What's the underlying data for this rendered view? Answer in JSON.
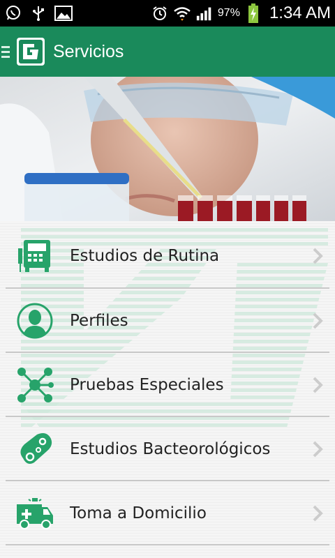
{
  "status_bar": {
    "battery": "97%",
    "time": "1:34 AM",
    "icons": [
      "whatsapp-icon",
      "usb-icon",
      "gallery-icon",
      "alarm-icon",
      "wifi-icon",
      "signal-icon",
      "battery-charging-icon"
    ]
  },
  "action_bar": {
    "title": "Servicios",
    "logo_text": "G"
  },
  "colors": {
    "primary": "#1a8a5b",
    "accent": "#27a36a",
    "text": "#222222",
    "chevron": "#cccccc"
  },
  "menu": {
    "items": [
      {
        "label": "Estudios de Rutina",
        "icon": "lab-analyzer-icon"
      },
      {
        "label": "Perfiles",
        "icon": "person-profile-icon"
      },
      {
        "label": "Pruebas Especiales",
        "icon": "molecule-icon"
      },
      {
        "label": "Estudios Bacteorológicos",
        "icon": "bacteria-icon"
      },
      {
        "label": "Toma a Domicilio",
        "icon": "ambulance-icon"
      }
    ]
  }
}
